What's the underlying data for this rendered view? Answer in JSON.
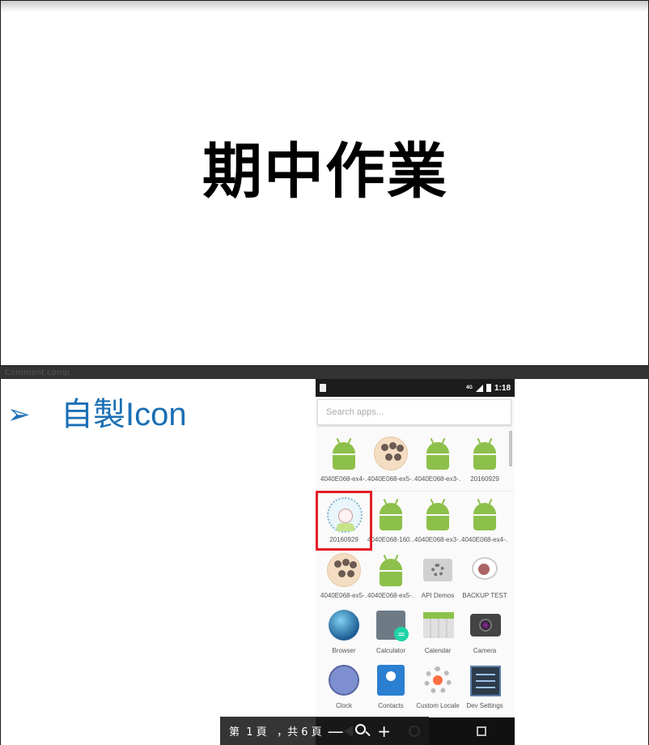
{
  "slide1": {
    "title": "期中作業"
  },
  "slide2": {
    "bullet": "➢",
    "title": "自製Icon",
    "hidden_label": "Comment comp"
  },
  "phone": {
    "status_time": "1:18",
    "status_network": "4G",
    "search_placeholder": "Search apps...",
    "apps": [
      [
        "4040E068-ex4-…",
        "4040E068-ex5-…",
        "4040E068-ex3-…",
        "20160929"
      ],
      [
        "20160929",
        "4040E068-160…",
        "4040E068-ex3-…",
        "4040E068-ex4-…"
      ],
      [
        "4040E068-ex5-…",
        "4040E068-ex5-…",
        "API Demos",
        "BACKUP TEST"
      ],
      [
        "Browser",
        "Calculator",
        "Calendar",
        "Camera"
      ],
      [
        "Clock",
        "Contacts",
        "Custom Locale",
        "Dev Settings"
      ]
    ]
  },
  "pager": {
    "text": "第  1 頁   ，共 6 頁",
    "zoom_out": "—",
    "zoom_in": "+"
  },
  "colors": {
    "accent": "#1a6fb5",
    "highlight": "#e41e26",
    "android_green": "#8dc04a"
  }
}
